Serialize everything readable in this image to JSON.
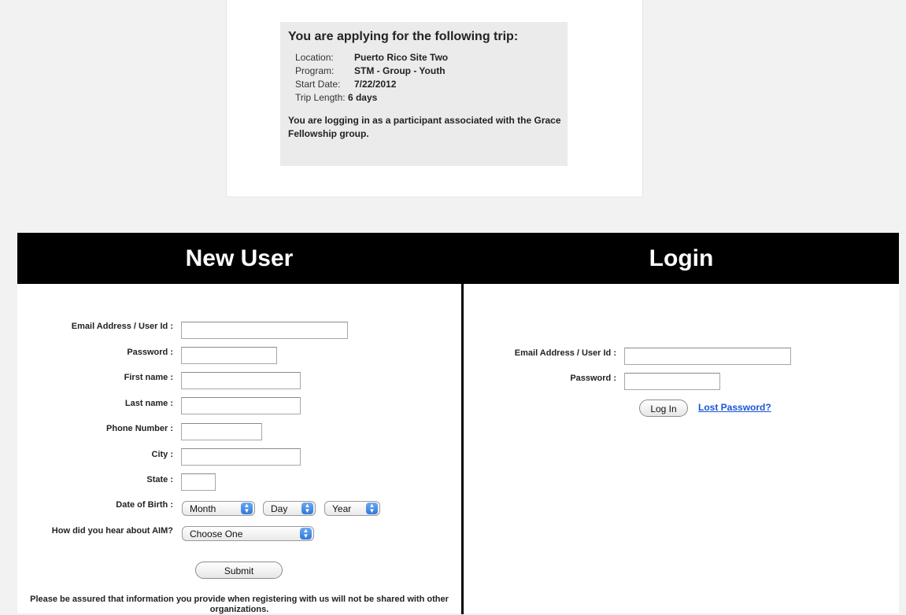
{
  "trip": {
    "heading": "You are applying for the following trip:",
    "rows": [
      {
        "label": "Location:",
        "value": "Puerto Rico Site Two"
      },
      {
        "label": "Program:",
        "value": "STM - Group - Youth"
      },
      {
        "label": "Start Date:",
        "value": "7/22/2012"
      },
      {
        "label": "Trip Length:",
        "value": "6 days"
      }
    ],
    "note": "You are logging in as a participant associated with the Grace Fellowship group."
  },
  "new_user": {
    "title": "New User",
    "fields": {
      "email": "Email Address / User Id :",
      "password": "Password :",
      "first_name": "First name :",
      "last_name": "Last name :",
      "phone": "Phone Number :",
      "city": "City :",
      "state": "State :",
      "dob": "Date of Birth :",
      "referral": "How did you hear about AIM?"
    },
    "dob_month": "Month",
    "dob_day": "Day",
    "dob_year": "Year",
    "referral_selected": "Choose One",
    "submit_label": "Submit",
    "privacy_note": "Please be assured that information you provide when registering with us will not be shared with other organizations."
  },
  "login": {
    "title": "Login",
    "email_label": "Email Address / User Id :",
    "password_label": "Password :",
    "login_button": "Log In",
    "lost_password": "Lost Password?"
  },
  "colors": {
    "header_bg": "#000000",
    "link": "#1a55d6",
    "select_arrow": "#2f78db"
  }
}
